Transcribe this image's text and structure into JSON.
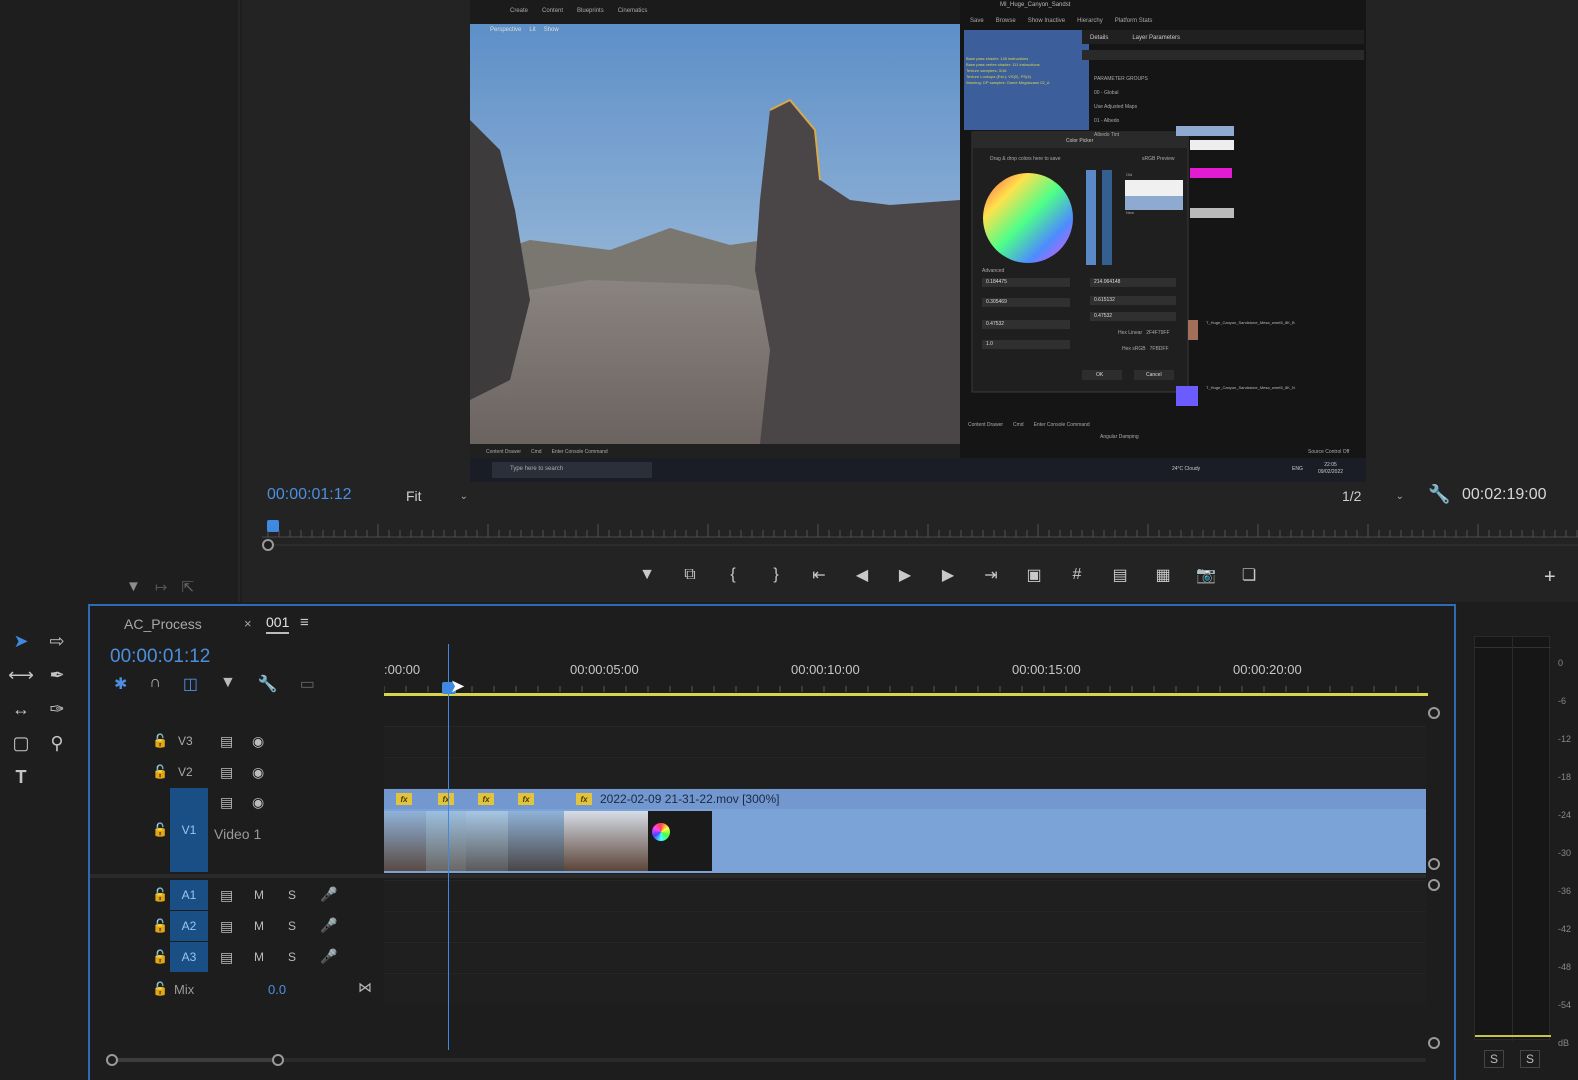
{
  "colors": {
    "accent": "#4c8fdf",
    "clip_blue": "#7ba3d8",
    "track_tag": "#1a4f86",
    "fx_yellow": "#e2c33c",
    "panel_border": "#2f6bb4"
  },
  "monitor": {
    "current_timecode": "00:00:01:12",
    "zoom": "Fit",
    "resolution": "1/2",
    "duration": "00:02:19:00"
  },
  "embedded_screen": {
    "ue_toolbar": [
      "Create",
      "Content",
      "Blueprints",
      "Cinematics"
    ],
    "viewport_buttons": [
      "Perspective",
      "Lit",
      "Show"
    ],
    "details_tabs": [
      "Details",
      "Layer Parameters"
    ],
    "material_tab": "MI_Huge_Canyon_Sandst",
    "editor_menu": [
      "Save",
      "Browse",
      "Show Inactive",
      "Hierarchy",
      "Platform Stats"
    ],
    "param_groups": [
      "PARAMETER GROUPS",
      "00 - Global",
      "Use Adjusted Maps",
      "01 - Albedo",
      "Albedo Tint"
    ],
    "stats_lines": [
      "Base pass shader: 145 instructions",
      "Base pass vertex shader: 111 instructions",
      "Texture samplers: 3/16",
      "Texture Lookups (Est.): VS(0), PS(4)",
      "Warning: DP samples: Game Megascans 02_A"
    ],
    "color_picker": {
      "title": "Color Picker",
      "drag_hint": "Drag & drop colors here to save",
      "srgb": "sRGB Preview",
      "old": "Old",
      "new": "New",
      "advanced": "Advanced",
      "r_value": "0.184475",
      "g_value": "0.305469",
      "b_value": "0.47532",
      "a_value": "1.0",
      "h_value": "214.064148",
      "s_value": "0.615132",
      "v_value": "0.47532",
      "hex_linear_label": "Hex Linear",
      "hex_linear": "2F4F79FF",
      "hex_srgb_label": "Hex sRGB",
      "hex_srgb": "7FBDFF",
      "ok": "OK",
      "cancel": "Cancel"
    },
    "texture_names": [
      "T_Huge_Canyon_Sandstone_Mesa_wmrt5_8K_B",
      "T_Huge_Canyon_Sandstone_Mesa_wmrt5_8K_N"
    ],
    "content_drawer": "Content Drawer",
    "cmd": "Cmd",
    "console_hint": "Enter Console Command",
    "angular_damping": "Angular Damping",
    "source_control": "Source Control Off",
    "search_hint": "Type here to search",
    "weather": "24°C Cloudy",
    "lang": "ENG",
    "clock_time": "22:05",
    "clock_date": "09/02/2022"
  },
  "timeline": {
    "sequence_tabs": [
      "AC_Process",
      "001"
    ],
    "timecode": "00:00:01:12",
    "ruler_labels": [
      ":00:00",
      "00:00:05:00",
      "00:00:10:00",
      "00:00:15:00",
      "00:00:20:00"
    ],
    "video_tracks": [
      {
        "id": "V3"
      },
      {
        "id": "V2"
      },
      {
        "id": "V1",
        "name": "Video 1"
      }
    ],
    "audio_tracks": [
      {
        "id": "A1",
        "m": "M",
        "s": "S"
      },
      {
        "id": "A2",
        "m": "M",
        "s": "S"
      },
      {
        "id": "A3",
        "m": "M",
        "s": "S"
      }
    ],
    "mix_label": "Mix",
    "mix_value": "0.0",
    "clip_name": "2022-02-09 21-31-22.mov [300%]",
    "fx": "fx",
    "meter_solo": [
      "S",
      "S"
    ],
    "meter_scale": [
      "0",
      "-6",
      "-12",
      "-18",
      "-24",
      "-30",
      "-36",
      "-42",
      "-48",
      "-54",
      "dB"
    ]
  }
}
